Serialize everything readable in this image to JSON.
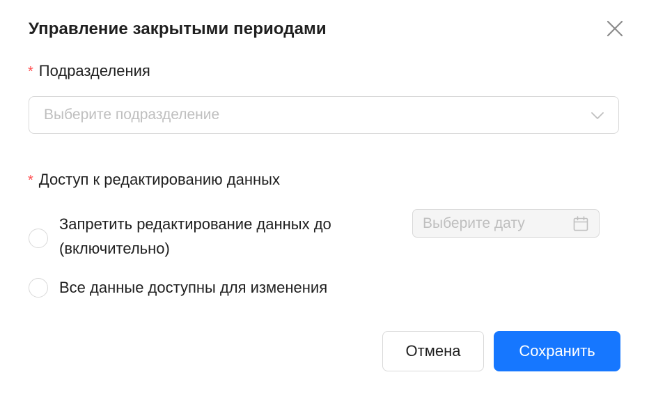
{
  "dialog": {
    "title": "Управление закрытыми периодами"
  },
  "form": {
    "division": {
      "label": "Подразделения",
      "required_mark": "*",
      "placeholder": "Выберите подразделение"
    },
    "access": {
      "label": "Доступ к редактированию данных",
      "required_mark": "*",
      "options": [
        {
          "label_line1": "Запретить редактирование данных до",
          "label_line2": "(включительно)",
          "selected": false
        },
        {
          "label": "Все данные доступны для изменения",
          "selected": false
        }
      ],
      "date_placeholder": "Выберите дату"
    }
  },
  "footer": {
    "cancel_label": "Отмена",
    "save_label": "Сохранить"
  },
  "colors": {
    "primary": "#1677ff",
    "required": "#ff4d4f",
    "placeholder": "#bfbfbf",
    "border": "#d9d9d9"
  }
}
